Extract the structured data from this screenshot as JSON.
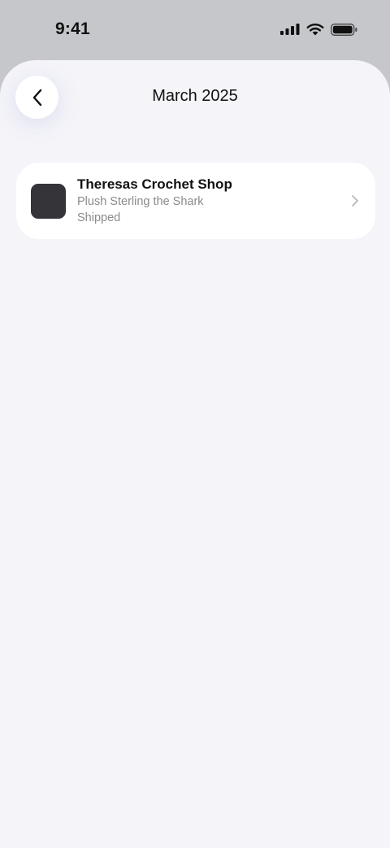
{
  "status_bar": {
    "time": "9:41",
    "icons": [
      "cellular-signal-icon",
      "wifi-icon",
      "battery-icon"
    ]
  },
  "header": {
    "title": "March 2025",
    "back_icon": "chevron-left-icon"
  },
  "orders": [
    {
      "shop": "Theresas Crochet Shop",
      "item": "Plush Sterling the Shark",
      "status": "Shipped",
      "chevron_icon": "chevron-right-icon"
    }
  ],
  "colors": {
    "status_bar_bg": "#c6c7cb",
    "sheet_bg": "#f4f4f9",
    "card_bg": "#ffffff",
    "thumbnail": "#353438",
    "secondary_text": "#8a8a8f"
  }
}
